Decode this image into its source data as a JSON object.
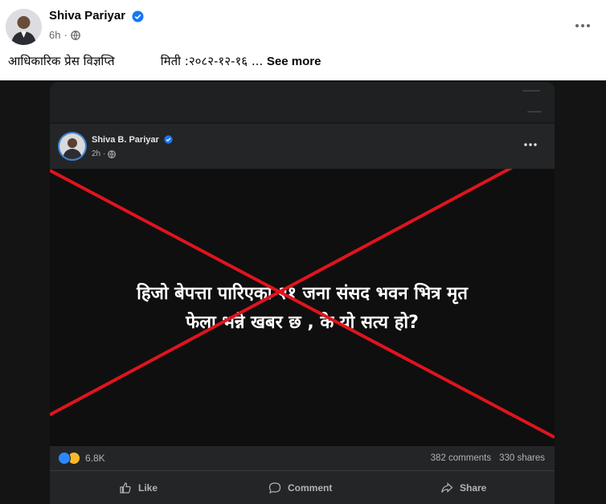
{
  "post": {
    "author": "Shiva Pariyar",
    "time": "6h",
    "separator": "·",
    "text": "आधिकारिक प्रेस विज्ञप्ति            मिती :२०८२-१२-१६ ...",
    "see_more": "See more"
  },
  "image": {
    "author": "Shiva B. Pariyar",
    "time": "2h",
    "separator": "·",
    "claim_line1": "हिजो बेपत्ता पारिएका २१ जना संसद भवन भित्र मृत",
    "claim_line2": "फेला भन्ने खबर छ , के यो सत्य हो?",
    "reaction_count": "6.8K",
    "comments": "382 comments",
    "shares": "330 shares",
    "like_label": "Like",
    "comment_label": "Comment",
    "share_label": "Share",
    "cross_color": "#e0141e"
  },
  "icons": [
    "verified-badge-icon",
    "globe-icon",
    "more-options-icon",
    "like-reaction-icon",
    "sad-reaction-icon",
    "thumbs-up-icon",
    "comment-icon",
    "share-icon"
  ]
}
